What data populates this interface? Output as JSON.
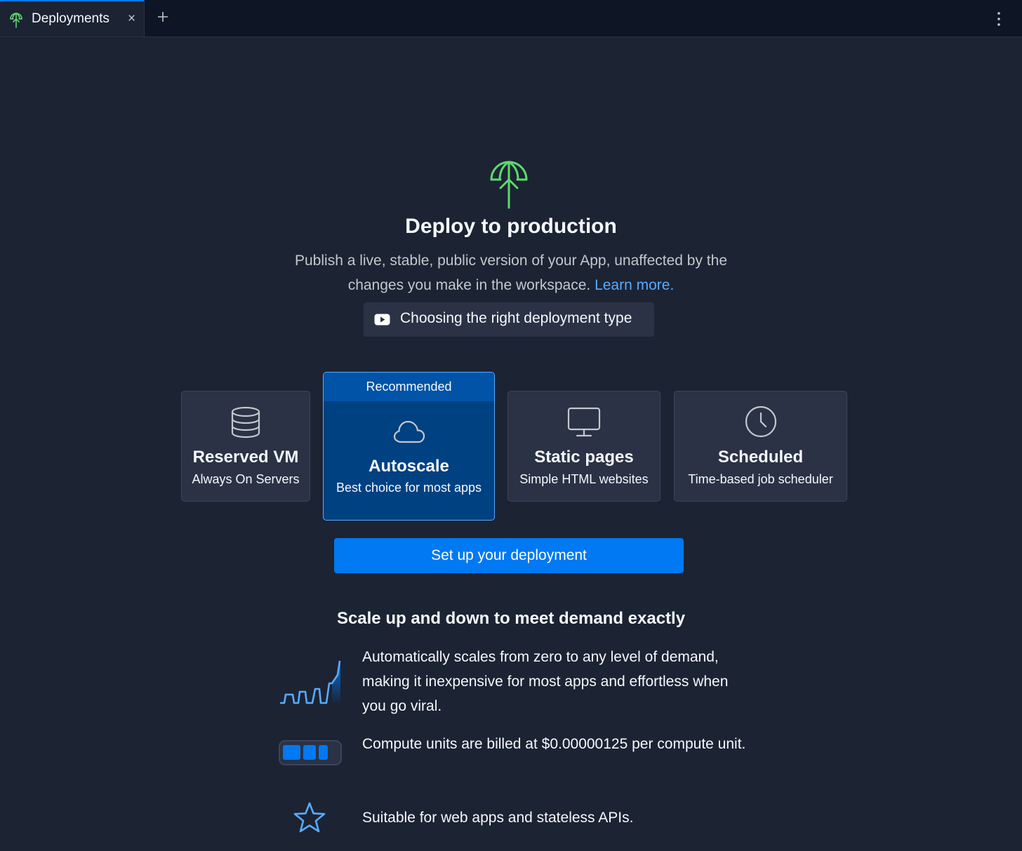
{
  "tabbar": {
    "tab_label": "Deployments",
    "close_glyph": "×",
    "accent": "#0079f2"
  },
  "hero": {
    "title": "Deploy to production",
    "subtitle": "Publish a live, stable, public version of your App, unaffected by the changes you make in the workspace.",
    "link_text": "Learn more.",
    "icon_color": "#5ed96e"
  },
  "video_button": {
    "label": "Choosing the right deployment type",
    "icon": "youtube-icon"
  },
  "cards": [
    {
      "name": "Reserved VM",
      "desc": "Always On Servers",
      "icon": "database-icon"
    },
    {
      "name": "Autoscale",
      "desc": "Best choice for most apps",
      "icon": "cloud-icon",
      "badge": "Recommended",
      "selected": true
    },
    {
      "name": "Static pages",
      "desc": "Simple HTML websites",
      "icon": "monitor-icon"
    },
    {
      "name": "Scheduled",
      "desc": "Time-based job scheduler",
      "icon": "clock-icon"
    }
  ],
  "cta": {
    "label": "Set up your deployment",
    "color": "#0079f2"
  },
  "features": {
    "title": "Scale up and down to meet demand exactly",
    "items": [
      {
        "text": "Automatically scales from zero to any level of demand, making it inexpensive for most apps and effortless when you go viral.",
        "icon": "scaling-graph-icon"
      },
      {
        "text": "Compute units are billed at $0.00000125 per compute unit.",
        "icon": "battery-units-icon"
      },
      {
        "text": "Suitable for web apps and stateless APIs.",
        "icon": "star-icon"
      }
    ]
  }
}
